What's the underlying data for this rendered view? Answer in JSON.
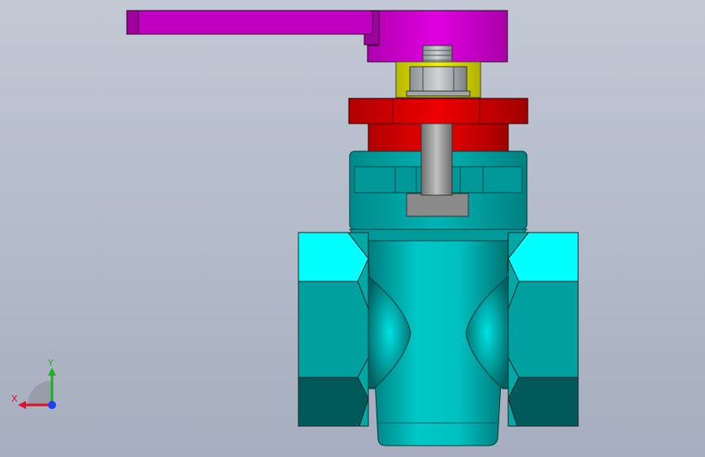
{
  "viewport": {
    "background_top": "#c2c8d4",
    "background_bottom": "#a6aebf"
  },
  "model": {
    "parts": [
      {
        "name": "handle-lever",
        "color": "#cc00cc"
      },
      {
        "name": "stem-nut",
        "color": "#9aa0a4"
      },
      {
        "name": "yellow-washer",
        "color": "#e0e000"
      },
      {
        "name": "red-gland-flange",
        "color": "#dd0000"
      },
      {
        "name": "stem",
        "color": "#9a9a9a"
      },
      {
        "name": "teal-bonnet",
        "color": "#00a8a8"
      },
      {
        "name": "valve-body",
        "color": "#00c0c0"
      },
      {
        "name": "hex-end-left",
        "color": "#00a0a0"
      },
      {
        "name": "hex-end-right",
        "color": "#00a0a0"
      }
    ]
  },
  "triad": {
    "x_label": "X",
    "y_label": "Y",
    "x_color": "#e0102a",
    "y_color": "#20b020",
    "z_color": "#2040ff"
  }
}
